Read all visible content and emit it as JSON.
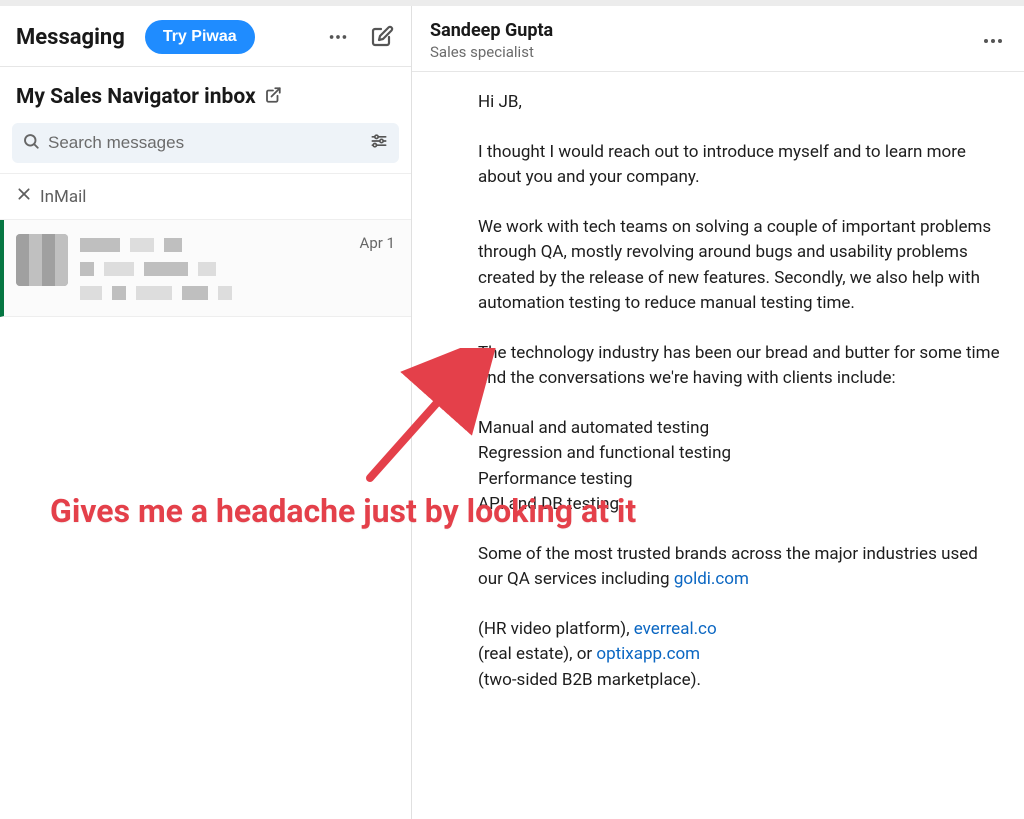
{
  "left": {
    "title": "Messaging",
    "try_button": "Try Piwaa",
    "inbox_title": "My Sales Navigator inbox",
    "search_placeholder": "Search messages",
    "inmail_label": "InMail",
    "message_date": "Apr 1"
  },
  "right": {
    "name": "Sandeep Gupta",
    "role": "Sales specialist"
  },
  "msg": {
    "greeting": "Hi JB,",
    "p1": "I thought I would reach out to introduce myself and to learn more about you and your company.",
    "p2": "We work with tech teams on solving a couple of important problems through QA, mostly revolving around bugs and usability problems created by the release of new features. Secondly, we also help with automation testing to reduce manual testing time.",
    "p3": "The technology industry has been our bread and butter for some time and the conversations we're having with clients include:",
    "bullets": "Manual and automated testing\nRegression and functional testing\nPerformance testing\nAPI and DB testing",
    "p4_a": "Some of the most trusted brands across the major industries used our QA services including ",
    "link1": "goldi.com",
    "p5_a": "(HR video platform), ",
    "link2": "everreal.co",
    "p6_a": "(real estate), or ",
    "link3": "optixapp.com",
    "p7": "(two-sided B2B marketplace)."
  },
  "annotation": "Gives me a headache just by looking at it"
}
